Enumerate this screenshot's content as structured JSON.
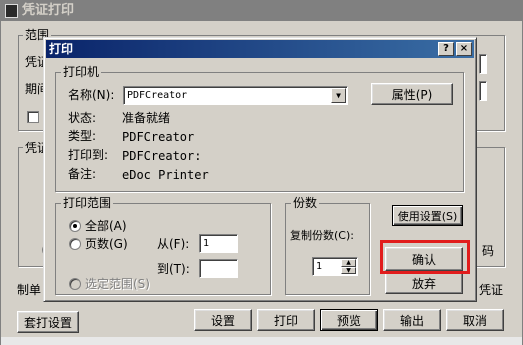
{
  "outer": {
    "title": "凭证打印",
    "labels": {
      "range": "范围",
      "voucher_short": "凭证",
      "period_short": "期间",
      "voucher_group": "凭证",
      "code": "码",
      "voucher_right": "凭证",
      "maker": "制单"
    },
    "buttons": {
      "template_setup": "套打设置",
      "settings": "设置",
      "print": "打印",
      "preview": "预览",
      "export": "输出",
      "cancel": "取消"
    }
  },
  "dialog": {
    "title": "打印",
    "help_btn": "?",
    "close_btn": "×",
    "printer": {
      "group_label": "打印机",
      "name_label": "名称(N):",
      "name_value": "PDFCreator",
      "properties_btn": "属性(P)",
      "status_label": "状态:",
      "status_value": "准备就绪",
      "type_label": "类型:",
      "type_value": "PDFCreator",
      "where_label": "打印到:",
      "where_value": "PDFCreator:",
      "comment_label": "备注:",
      "comment_value": "eDoc Printer"
    },
    "range": {
      "group_label": "打印范围",
      "all": "全部(A)",
      "pages": "页数(G)",
      "from_label": "从(F):",
      "from_value": "1",
      "to_label": "到(T):",
      "to_value": "",
      "selection": "选定范围(S)",
      "selected": "all"
    },
    "copies": {
      "group_label": "份数",
      "count_label": "复制份数(C):",
      "count_value": "1"
    },
    "buttons": {
      "use_settings": "使用设置(S)",
      "ok": "确认",
      "abandon": "放弃"
    }
  },
  "colors": {
    "face": "#d4d0c8",
    "title_active": "#0a246a",
    "title_inactive": "#808080",
    "highlight_box": "#e11c1c"
  }
}
